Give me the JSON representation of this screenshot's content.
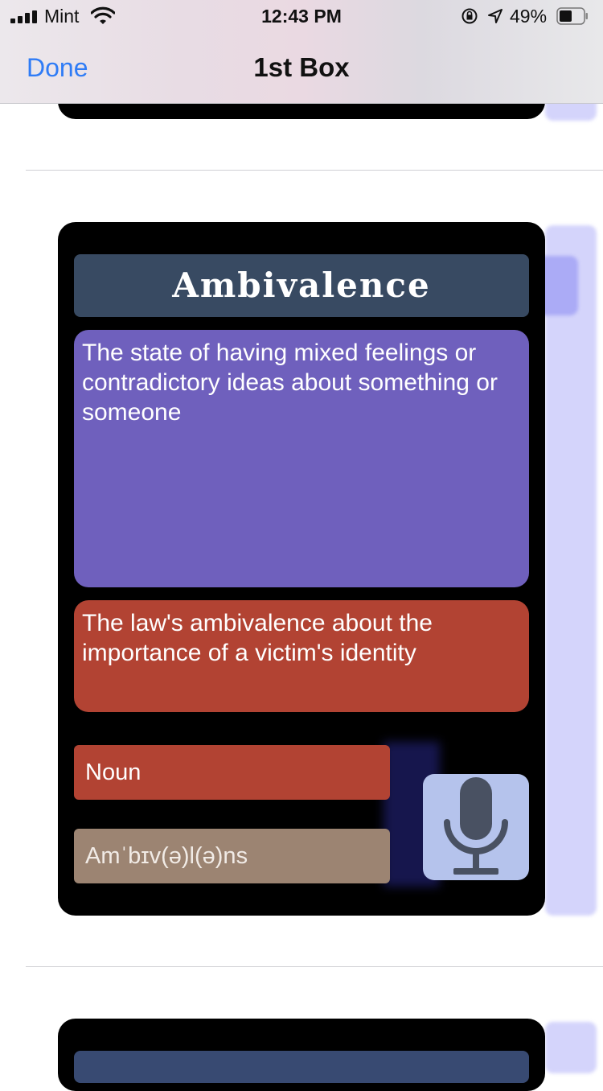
{
  "status_bar": {
    "carrier": "Mint",
    "time": "12:43 PM",
    "battery_percent": "49%",
    "icons": [
      "signal-icon",
      "wifi-icon",
      "rotation-lock-icon",
      "location-arrow-icon",
      "battery-icon"
    ]
  },
  "nav": {
    "done_label": "Done",
    "title": "1st Box"
  },
  "card": {
    "word": "Ambivalence",
    "definition": "The state of having mixed feelings or contradictory ideas about something or someone",
    "example": "The law's ambivalence about the importance of a victim's identity",
    "part_of_speech": "Noun",
    "pronunciation": "Amˈbɪv(ə)l(ə)ns",
    "mic_icon": "microphone-icon"
  },
  "colors": {
    "accent": "#2f7cf6",
    "word_bar": "#384a62",
    "definition_bg": "#6f60bd",
    "example_bg": "#b24333",
    "pronunciation_bg": "#9c8472",
    "mic_bg": "#b5c3ec"
  }
}
